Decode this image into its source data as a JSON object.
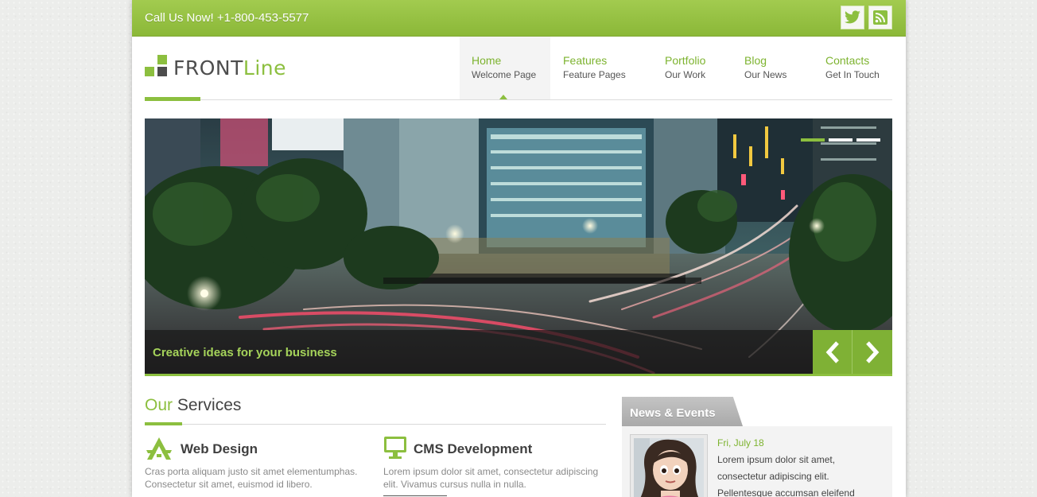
{
  "topbar": {
    "phone": "Call Us Now! +1-800-453-5577",
    "social_icons": [
      "twitter-icon",
      "rss-icon"
    ]
  },
  "logo": {
    "part1": "FRONT",
    "part2": "Line"
  },
  "nav": {
    "items": [
      {
        "title": "Home",
        "subtitle": "Welcome Page",
        "active": true
      },
      {
        "title": "Features",
        "subtitle": "Feature Pages",
        "active": false
      },
      {
        "title": "Portfolio",
        "subtitle": "Our Work",
        "active": false
      },
      {
        "title": "Blog",
        "subtitle": "Our News",
        "active": false
      },
      {
        "title": "Contacts",
        "subtitle": "Get In Touch",
        "active": false
      }
    ]
  },
  "slider": {
    "caption": "Creative ideas for your business",
    "slide_count": 3,
    "active_slide": 1,
    "prev_icon": "chevron-left-icon",
    "next_icon": "chevron-right-icon"
  },
  "services": {
    "heading_accent": "Our",
    "heading_rest": " Services",
    "items": [
      {
        "title": "Web Design",
        "description": "Cras porta aliquam justo sit amet elementumphas. Consectetur sit amet, euismod id libero.",
        "icon": "web-design-icon"
      },
      {
        "title": "CMS Development",
        "description": "Lorem ipsum dolor sit amet, consectetur adipiscing elit. Vivamus cursus nulla in nulla.",
        "icon": "monitor-icon"
      }
    ]
  },
  "news": {
    "tab_label": "News & Events",
    "date": "Fri, July 18",
    "text": "Lorem ipsum dolor sit amet, consectetur adipiscing elit. Pellentesque accumsan eleifend"
  },
  "colors": {
    "accent": "#8cbf3f",
    "topbar": "#97c244",
    "text_dark": "#444444",
    "text_muted": "#8a8a8a"
  }
}
